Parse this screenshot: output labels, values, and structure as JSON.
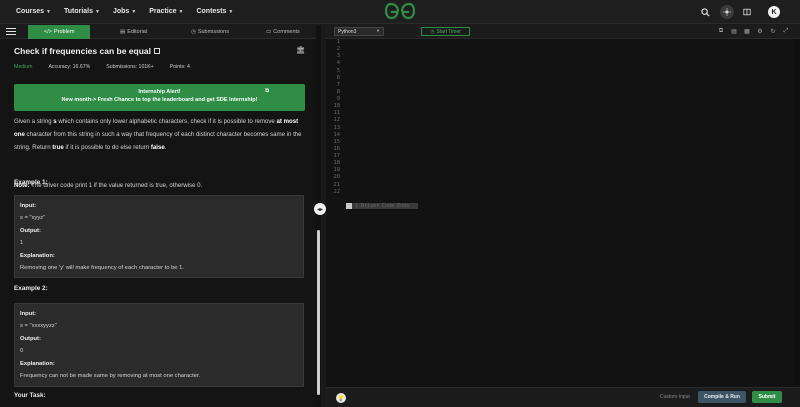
{
  "nav": {
    "menu": [
      {
        "label": "Courses"
      },
      {
        "label": "Tutorials"
      },
      {
        "label": "Jobs"
      },
      {
        "label": "Practice"
      },
      {
        "label": "Contests"
      }
    ],
    "avatar_letter": "K"
  },
  "tabs": {
    "problem": "Problem",
    "editorial": "Editorial",
    "submissions": "Submissions",
    "comments": "Comments"
  },
  "problem": {
    "title": "Check if frequencies can be equal",
    "difficulty": "Medium",
    "accuracy": "Accuracy: 16.67%",
    "submissions": "Submissions: 101K+",
    "points": "Points: 4"
  },
  "alert": {
    "line1": "Internship Alert!",
    "line2": "New month-> Fresh Chance to top the leaderboard and get SDE Internship!"
  },
  "description": {
    "p1_a": "Given a string ",
    "p1_s": "s",
    "p1_b": " which contains only lower alphabetic characters, check if it is possible to remove ",
    "p1_atmost": "at most one",
    "p1_c": " character from this string in such a way that frequency of each distinct character becomes same in the string. Return ",
    "p1_true": "true",
    "p1_d": " if it is possible to do else return ",
    "p1_false": "false",
    "p1_e": ".",
    "note_label": "Note:",
    "note_text": " The driver code print 1 if the value returned is true, otherwise 0."
  },
  "examples": [
    {
      "title": "Example 1:",
      "input_label": "Input:",
      "input": "s = \"xyyz\"",
      "output_label": "Output:",
      "output": "1",
      "explanation_label": "Explanation:",
      "explanation": "Removing one 'y' will make frequency of each character to be 1."
    },
    {
      "title": "Example 2:",
      "input_label": "Input:",
      "input": "s = \"xxxxyyzz\"",
      "output_label": "Output:",
      "output": "0",
      "explanation_label": "Explanation:",
      "explanation": "Frequency can not be made same by removing at most one character."
    }
  ],
  "your_task": "Your Task:",
  "editor": {
    "language": "Python3",
    "timer_label": "Start Timer",
    "line_numbers": [
      "1",
      "2",
      "3",
      "4",
      "5",
      "6",
      "7",
      "8",
      "9",
      "10",
      "11",
      "12",
      "13",
      "14",
      "15",
      "16",
      "17",
      "18",
      "19",
      "20",
      "21",
      "22"
    ],
    "driver_hint": "} Driver Code Ends"
  },
  "bottom": {
    "custom_input": "Custom Input",
    "compile_run": "Compile & Run",
    "submit": "Submit"
  },
  "colors": {
    "accent_green": "#2f8d46",
    "compile_blue": "#3d5564"
  }
}
